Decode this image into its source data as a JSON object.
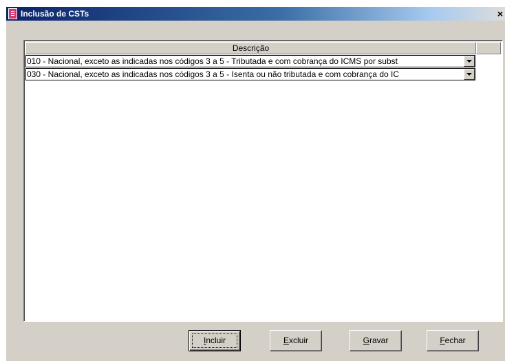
{
  "window": {
    "title": "Inclusão de CSTs",
    "close_label": "×"
  },
  "grid": {
    "column_header": "Descrição",
    "rows": [
      {
        "value": "010 - Nacional, exceto as indicadas nos códigos 3 a 5 - Tributada e com cobrança do ICMS por subst"
      },
      {
        "value": "030 - Nacional, exceto as indicadas nos códigos 3 a 5 - Isenta ou não tributada e com cobrança do IC"
      }
    ]
  },
  "buttons": {
    "incluir": {
      "mnemonic": "I",
      "rest": "ncluir"
    },
    "excluir": {
      "mnemonic": "E",
      "rest": "xcluir"
    },
    "gravar": {
      "mnemonic": "G",
      "rest": "ravar"
    },
    "fechar": {
      "mnemonic": "F",
      "rest": "echar"
    }
  },
  "icons": {
    "title_icon": "document-icon",
    "dropdown": "chevron-down-icon"
  }
}
